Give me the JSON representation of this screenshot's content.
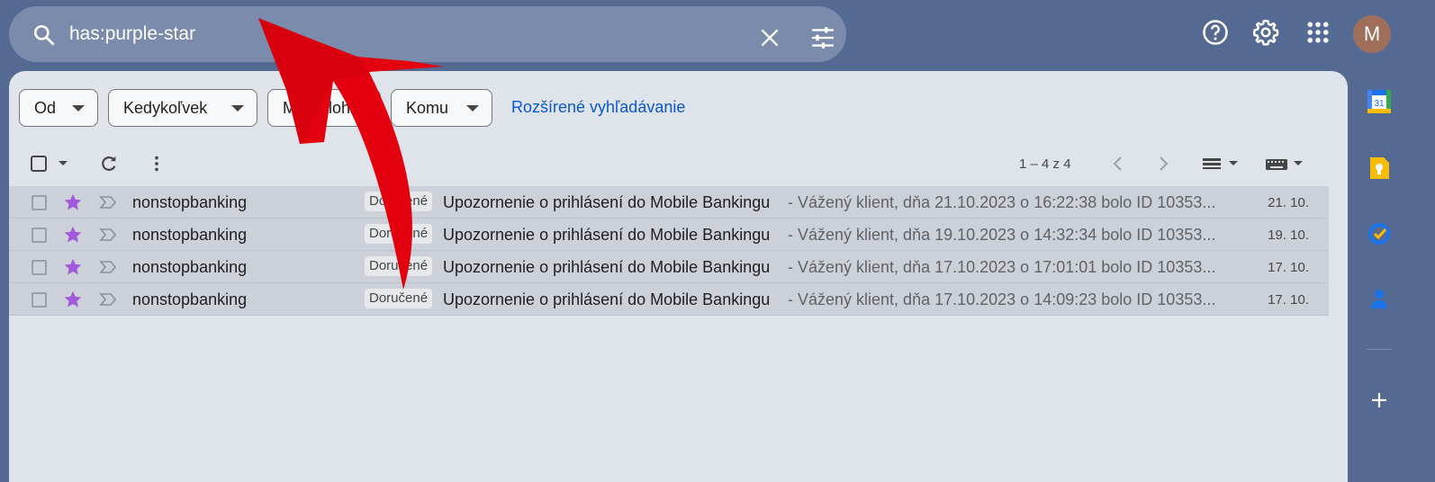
{
  "search": {
    "query": "has:purple-star"
  },
  "account": {
    "initial": "M"
  },
  "filters": {
    "from": "Od",
    "anytime": "Kedykoľvek",
    "attachment": "Má prílohu",
    "to": "Komu",
    "advanced": "Rozšírené vyhľadávanie"
  },
  "pager": {
    "range": "1 – 4 z 4"
  },
  "emails": [
    {
      "sender": "nonstopbanking",
      "label": "Doručené",
      "subject": "Upozornenie o prihlásení do Mobile Bankingu",
      "snippet": "- Vážený klient, dňa 21.10.2023 o 16:22:38 bolo ID 10353...",
      "date": "21. 10."
    },
    {
      "sender": "nonstopbanking",
      "label": "Doručené",
      "subject": "Upozornenie o prihlásení do Mobile Bankingu",
      "snippet": "- Vážený klient, dňa 19.10.2023 o 14:32:34 bolo ID 10353...",
      "date": "19. 10."
    },
    {
      "sender": "nonstopbanking",
      "label": "Doručené",
      "subject": "Upozornenie o prihlásení do Mobile Bankingu",
      "snippet": "- Vážený klient, dňa 17.10.2023 o 17:01:01 bolo ID 10353...",
      "date": "17. 10."
    },
    {
      "sender": "nonstopbanking",
      "label": "Doručené",
      "subject": "Upozornenie o prihlásení do Mobile Bankingu",
      "snippet": "- Vážený klient, dňa 17.10.2023 o 14:09:23 bolo ID 10353...",
      "date": "17. 10."
    }
  ],
  "sidebar": {
    "calendar_day": "31"
  },
  "colors": {
    "background": "#556a92",
    "panel": "#dfe3ea",
    "star": "#a259d9",
    "link": "#0b57d0",
    "arrow": "#e3000f"
  },
  "icons": [
    "search-icon",
    "clear-icon",
    "tune-icon",
    "help-icon",
    "settings-icon",
    "apps-icon",
    "refresh-icon",
    "more-icon",
    "star-icon",
    "importance-icon",
    "calendar-icon",
    "keep-icon",
    "tasks-icon",
    "contacts-icon",
    "add-icon"
  ]
}
